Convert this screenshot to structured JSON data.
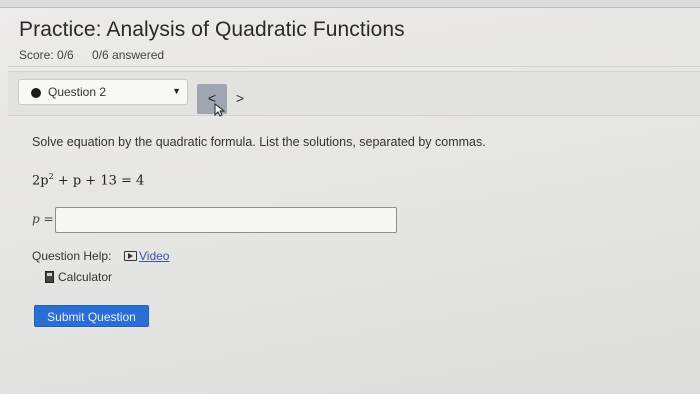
{
  "header": {
    "title": "Practice: Analysis of Quadratic Functions",
    "score": "Score: 0/6",
    "answered": "0/6 answered"
  },
  "question_nav": {
    "selected_question": "Question 2",
    "prev_glyph": "<",
    "next_glyph": ">"
  },
  "question": {
    "instructions": "Solve equation by the quadratic formula. List the solutions, separated by commas.",
    "equation_coef": "2p",
    "equation_exp": "2",
    "equation_rest": " + p + 13 = 4",
    "answer_label": "p =",
    "answer_value": ""
  },
  "help": {
    "label": "Question Help:",
    "video_label": "Video",
    "calculator_label": "Calculator"
  },
  "actions": {
    "submit_label": "Submit Question"
  },
  "colors": {
    "submit_bg": "#2a6fd6",
    "nav_active": "#9fa6b1",
    "link": "#3a56a8"
  },
  "icons": [
    "dropdown-caret-icon",
    "video-icon",
    "calculator-icon",
    "mouse-cursor-icon"
  ]
}
